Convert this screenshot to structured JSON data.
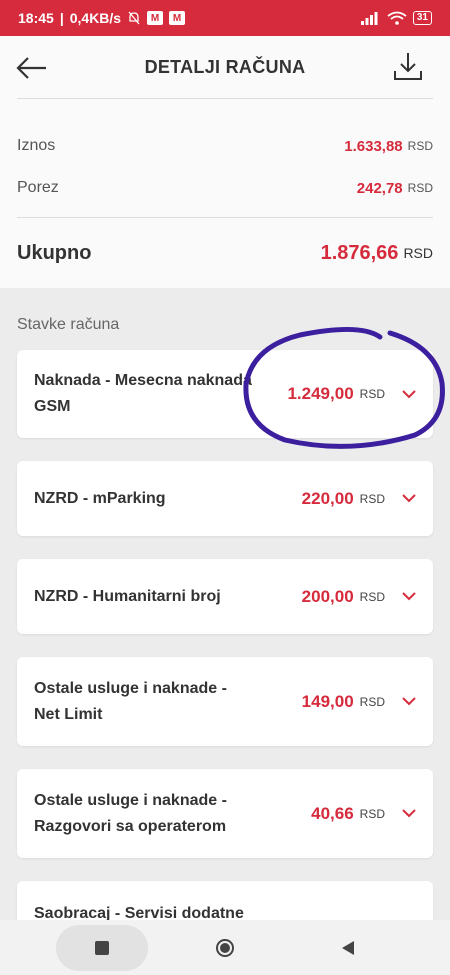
{
  "status_bar": {
    "time": "18:45",
    "speed": "0,4KB/s",
    "battery": "31"
  },
  "header": {
    "title": "DETALJI RAČUNA"
  },
  "summary": {
    "iznos_label": "Iznos",
    "iznos_value": "1.633,88",
    "porez_label": "Porez",
    "porez_value": "242,78",
    "ukupno_label": "Ukupno",
    "ukupno_value": "1.876,66",
    "currency": "RSD"
  },
  "items_section": {
    "label": "Stavke računa",
    "items": [
      {
        "name": "Naknada - Mesecna naknada GSM",
        "amount": "1.249,00",
        "currency": "RSD"
      },
      {
        "name": "NZRD - mParking",
        "amount": "220,00",
        "currency": "RSD"
      },
      {
        "name": "NZRD - Humanitarni broj",
        "amount": "200,00",
        "currency": "RSD"
      },
      {
        "name": "Ostale usluge i naknade - Net Limit",
        "amount": "149,00",
        "currency": "RSD"
      },
      {
        "name": "Ostale usluge i naknade - Razgovori sa operaterom",
        "amount": "40,66",
        "currency": "RSD"
      },
      {
        "name": "Saobracaj - Servisi dodatne",
        "amount": "",
        "currency": ""
      }
    ]
  },
  "colors": {
    "accent": "#d62b3c",
    "annotation": "#3b1f9e"
  },
  "icons": {
    "back": "arrow-left-icon",
    "download": "download-icon",
    "expand": "chevron-down-icon"
  }
}
